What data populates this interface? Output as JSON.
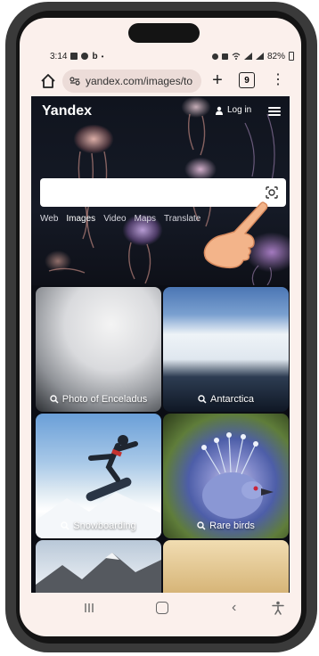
{
  "status_bar": {
    "time": "3:14",
    "battery": "82%"
  },
  "browser": {
    "url": "yandex.com/images/to",
    "tab_count": "9"
  },
  "yandex": {
    "logo": "Yandex",
    "login": "Log in",
    "search_placeholder": "",
    "services": [
      "Web",
      "Images",
      "Video",
      "Maps",
      "Translate"
    ],
    "active_service": "Images"
  },
  "tiles": [
    {
      "label": "Photo of Enceladus"
    },
    {
      "label": "Antarctica"
    },
    {
      "label": "Snowboarding"
    },
    {
      "label": "Rare birds"
    },
    {
      "label": ""
    },
    {
      "label": ""
    }
  ],
  "colors": {
    "accent": "#ffffff",
    "page_bg": "#0b0d14",
    "chrome_bg": "#fbf0ec",
    "url_bg": "#ecdcd8"
  }
}
